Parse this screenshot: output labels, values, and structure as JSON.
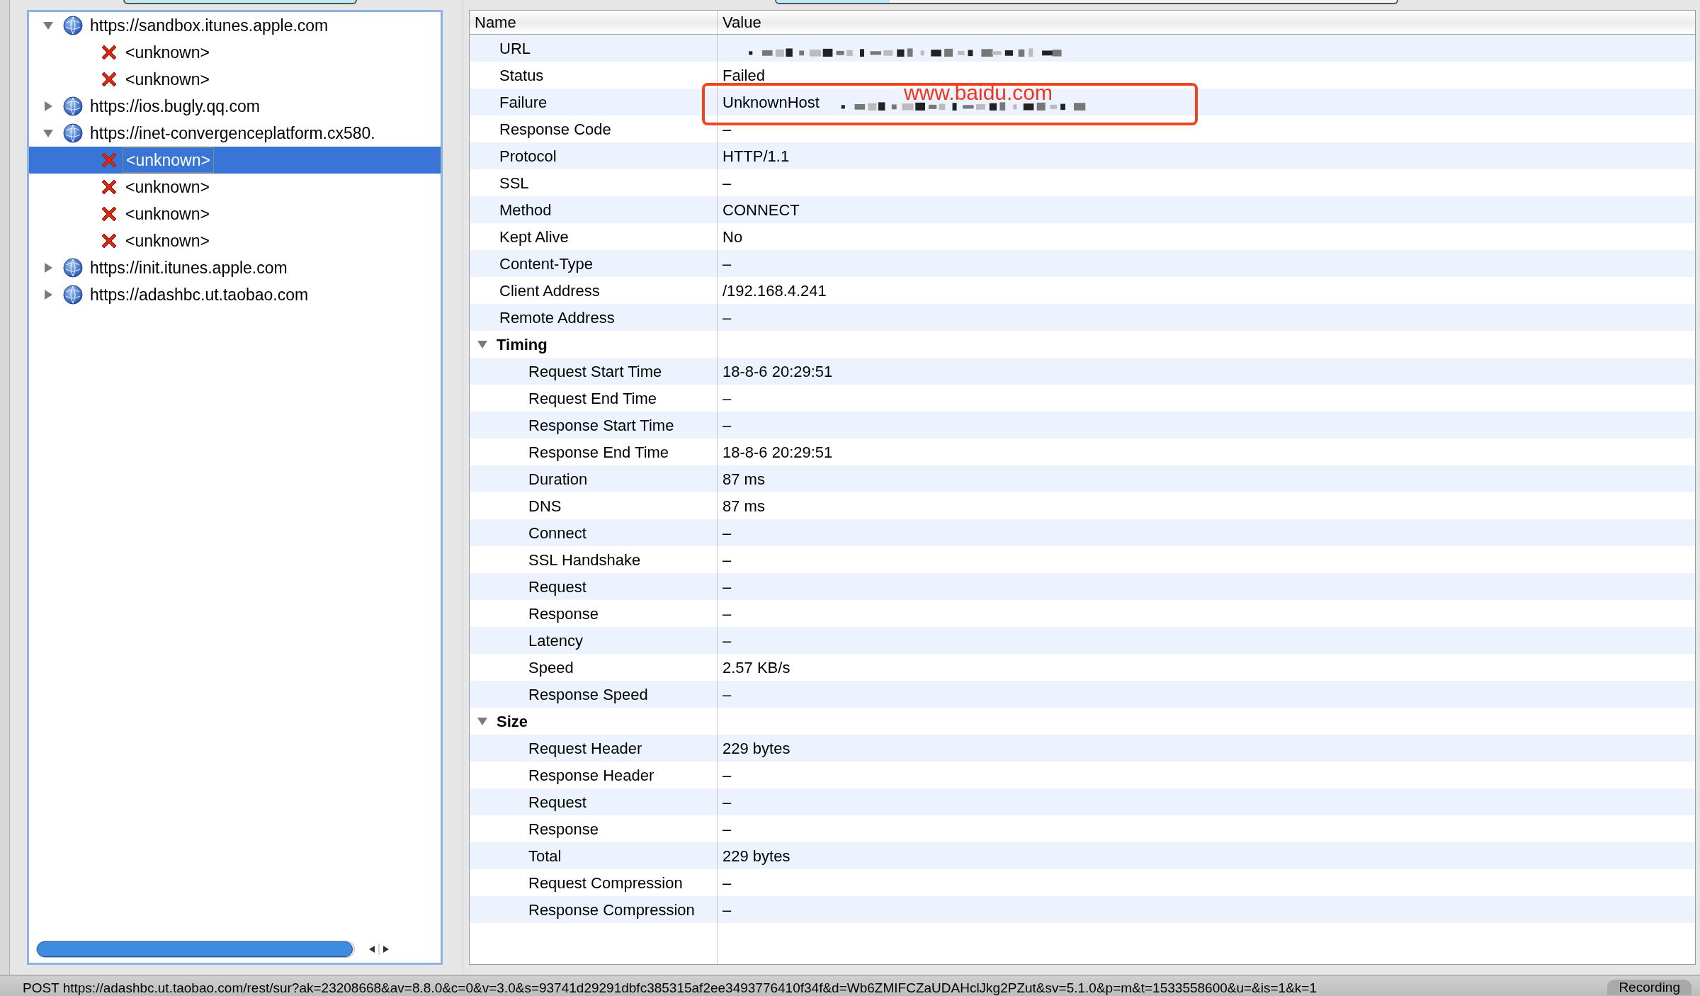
{
  "tree": [
    {
      "label": "https://sandbox.itunes.apple.com",
      "kind": "host",
      "expanded": true,
      "selected": false,
      "children": [
        {
          "label": "<unknown>",
          "kind": "failed",
          "selected": false
        },
        {
          "label": "<unknown>",
          "kind": "failed",
          "selected": false
        }
      ]
    },
    {
      "label": "https://ios.bugly.qq.com",
      "kind": "host",
      "expanded": false,
      "selected": false
    },
    {
      "label": "https://inet-convergenceplatform.cx580.",
      "kind": "host",
      "expanded": true,
      "selected": false,
      "children": [
        {
          "label": "<unknown>",
          "kind": "failed",
          "selected": true
        },
        {
          "label": "<unknown>",
          "kind": "failed",
          "selected": false
        },
        {
          "label": "<unknown>",
          "kind": "failed",
          "selected": false
        },
        {
          "label": "<unknown>",
          "kind": "failed",
          "selected": false
        }
      ]
    },
    {
      "label": "https://init.itunes.apple.com",
      "kind": "host",
      "expanded": false,
      "selected": false
    },
    {
      "label": "https://adashbc.ut.taobao.com",
      "kind": "host",
      "expanded": false,
      "selected": false
    }
  ],
  "table": {
    "columns": [
      "Name",
      "Value"
    ],
    "rows": [
      {
        "kind": "property",
        "name": "URL",
        "blurred": true
      },
      {
        "kind": "property",
        "name": "Status",
        "value": "Failed"
      },
      {
        "kind": "property",
        "name": "Failure",
        "value": "UnknownHost",
        "blurred": true,
        "annotation": "www.baidu.com"
      },
      {
        "kind": "property",
        "name": "Response Code",
        "value": "–"
      },
      {
        "kind": "property",
        "name": "Protocol",
        "value": "HTTP/1.1"
      },
      {
        "kind": "property",
        "name": "SSL",
        "value": "–"
      },
      {
        "kind": "property",
        "name": "Method",
        "value": "CONNECT"
      },
      {
        "kind": "property",
        "name": "Kept Alive",
        "value": "No"
      },
      {
        "kind": "property",
        "name": "Content-Type",
        "value": "–"
      },
      {
        "kind": "property",
        "name": "Client Address",
        "value": "/192.168.4.241"
      },
      {
        "kind": "property",
        "name": "Remote Address",
        "value": "–"
      },
      {
        "kind": "section",
        "name": "Timing",
        "expanded": true,
        "children": [
          {
            "kind": "property",
            "name": "Request Start Time",
            "value": "18-8-6 20:29:51"
          },
          {
            "kind": "property",
            "name": "Request End Time",
            "value": "–"
          },
          {
            "kind": "property",
            "name": "Response Start Time",
            "value": "–"
          },
          {
            "kind": "property",
            "name": "Response End Time",
            "value": "18-8-6 20:29:51"
          },
          {
            "kind": "property",
            "name": "Duration",
            "value": "87 ms"
          },
          {
            "kind": "property",
            "name": "DNS",
            "value": "87 ms"
          },
          {
            "kind": "property",
            "name": "Connect",
            "value": "–"
          },
          {
            "kind": "property",
            "name": "SSL Handshake",
            "value": "–"
          },
          {
            "kind": "property",
            "name": "Request",
            "value": "–"
          },
          {
            "kind": "property",
            "name": "Response",
            "value": "–"
          },
          {
            "kind": "property",
            "name": "Latency",
            "value": "–"
          },
          {
            "kind": "property",
            "name": "Speed",
            "value": "2.57 KB/s"
          },
          {
            "kind": "property",
            "name": "Response Speed",
            "value": "–"
          }
        ]
      },
      {
        "kind": "section",
        "name": "Size",
        "expanded": true,
        "children": [
          {
            "kind": "property",
            "name": "Request Header",
            "value": "229 bytes"
          },
          {
            "kind": "property",
            "name": "Response Header",
            "value": "–"
          },
          {
            "kind": "property",
            "name": "Request",
            "value": "–"
          },
          {
            "kind": "property",
            "name": "Response",
            "value": "–"
          },
          {
            "kind": "property",
            "name": "Total",
            "value": "229 bytes"
          },
          {
            "kind": "property",
            "name": "Request Compression",
            "value": "–"
          },
          {
            "kind": "property",
            "name": "Response Compression",
            "value": "–"
          }
        ]
      }
    ]
  },
  "status_bar": {
    "text": "POST https://adashbc.ut.taobao.com/rest/sur?ak=23208668&av=8.8.0&c=0&v=3.0&s=93741d29291dbfc385315af2ee3493776410f34f&d=Wb6ZMIFCZaUDAHclJkg2PZut&sv=5.1.0&p=m&t=1533558600&u=&is=1&k=1",
    "button": "Recording"
  }
}
